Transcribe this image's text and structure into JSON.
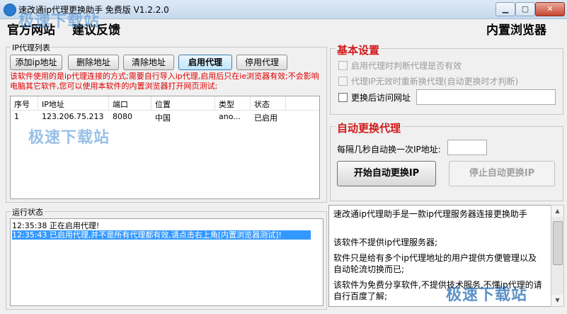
{
  "window": {
    "title": "速改通ip代理更换助手 免费版 V1.2.2.0",
    "min_glyph": "▁",
    "max_glyph": "▢",
    "close_glyph": "✕"
  },
  "header": {
    "official_site": "官方网站",
    "feedback": "建议反馈",
    "builtin_browser": "内置浏览器"
  },
  "watermark": {
    "text": "极速下载站"
  },
  "proxy_list": {
    "caption": "IP代理列表",
    "buttons": {
      "add": "添加ip地址",
      "delete": "删除地址",
      "clear": "清除地址",
      "enable": "启用代理",
      "disable": "停用代理"
    },
    "notice": "该软件使用的是ip代理连接的方式;需要自行导入ip代理,启用后只在ie浏览器有效;不会影响电脑其它软件,您可以使用本软件的内置浏览器打开网页测试;",
    "columns": [
      "序号",
      "IP地址",
      "端口",
      "位置",
      "类型",
      "状态"
    ],
    "rows": [
      [
        "1",
        "123.206.75.213",
        "8080",
        "中国",
        "ano...",
        "已启用"
      ]
    ]
  },
  "log": {
    "caption": "运行状态",
    "lines": [
      "12:35:38 正在启用代理!",
      "12:35:43 已启用代理,并不是所有代理都有效,请点击右上角[内置浏览器测试]!"
    ]
  },
  "basic_settings": {
    "title": "基本设置",
    "opt1": "启用代理时判断代理是否有效",
    "opt2": "代理IP无效时重新换代理(自动更换时才判断)",
    "opt3": "更换后访问网址"
  },
  "auto_switch": {
    "title": "自动更换代理",
    "interval_label": "每隔几秒自动换一次IP地址:",
    "start": "开始自动更换IP",
    "stop": "停止自动更换IP"
  },
  "description": {
    "p1": "速改通ip代理助手是一款ip代理服务器连接更换助手",
    "p2": "该软件不提供ip代理服务器;",
    "p3": "软件只是给有多个ip代理地址的用户提供方便管理以及自动轮流切换而已;",
    "p4": "该软件为免费分享软件,不提供技术服务,不懂ip代理的请自行百度了解;"
  },
  "scrollbar": {
    "up": "▲",
    "down": "▼"
  }
}
